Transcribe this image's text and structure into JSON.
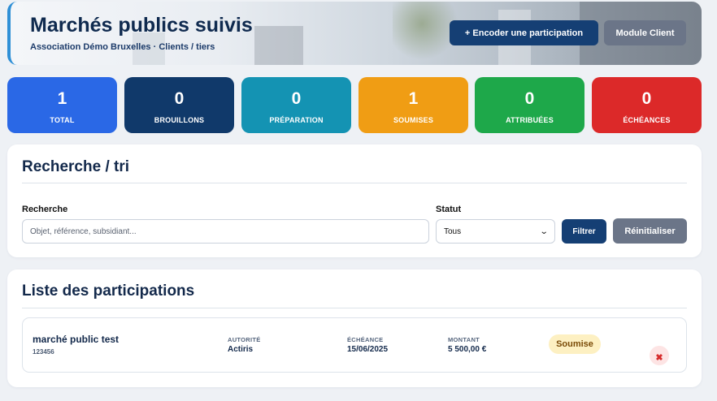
{
  "header": {
    "title": "Marchés publics suivis",
    "subtitle": "Association Démo Bruxelles · Clients / tiers",
    "encode_button": "+ Encoder une participation",
    "module_button": "Module Client"
  },
  "stats": [
    {
      "value": "1",
      "label": "TOTAL",
      "color": "#2a68e6"
    },
    {
      "value": "0",
      "label": "BROUILLONS",
      "color": "#10396a"
    },
    {
      "value": "0",
      "label": "PRÉPARATION",
      "color": "#1493b3"
    },
    {
      "value": "1",
      "label": "SOUMISES",
      "color": "#f09d14"
    },
    {
      "value": "0",
      "label": "ATTRIBUÉES",
      "color": "#1ea84a"
    },
    {
      "value": "0",
      "label": "ÉCHÉANCES",
      "color": "#dc2929"
    }
  ],
  "search": {
    "title": "Recherche / tri",
    "search_label": "Recherche",
    "search_placeholder": "Objet, référence, subsidiant...",
    "search_value": "",
    "status_label": "Statut",
    "status_value": "Tous",
    "filter_button": "Filtrer",
    "reset_button": "Réinitialiser"
  },
  "list": {
    "title": "Liste des participations",
    "columns": {
      "authority": "AUTORITÉ",
      "deadline": "ÉCHÉANCE",
      "amount": "MONTANT"
    },
    "rows": [
      {
        "title": "marché public test",
        "reference": "123456",
        "authority": "Actiris",
        "deadline": "15/06/2025",
        "amount": "5 500,00 €",
        "status": "Soumise",
        "delete_icon": "✖"
      }
    ]
  }
}
